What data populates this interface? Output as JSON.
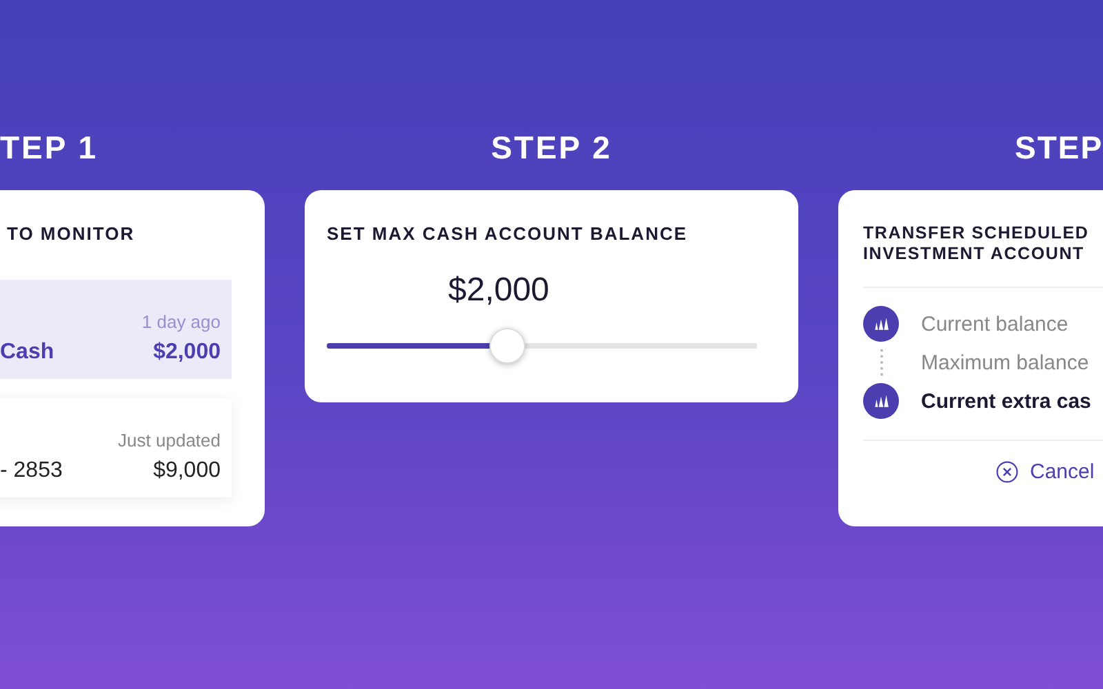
{
  "steps": [
    {
      "heading": "TEP 1",
      "card": {
        "kind": "accounts",
        "title": "TO MONITOR",
        "rows": [
          {
            "name": "Cash",
            "time": "1 day ago",
            "amount": "$2,000",
            "selected": true
          },
          {
            "name": "- 2853",
            "time": "Just updated",
            "amount": "$9,000",
            "selected": false
          }
        ]
      }
    },
    {
      "heading": "STEP 2",
      "card": {
        "kind": "slider",
        "title": "SET MAX CASH ACCOUNT BALANCE",
        "value": "$2,000",
        "level": 0.42
      }
    },
    {
      "heading": "STEP",
      "card": {
        "kind": "transfer",
        "title": "TRANSFER SCHEDULED INVESTMENT ACCOUNT",
        "items": [
          {
            "kind": "step",
            "label": "Current balance",
            "emphasized": false
          },
          {
            "kind": "note",
            "label": "Maximum balance",
            "emphasized": false
          },
          {
            "kind": "step",
            "label": "Current extra cas",
            "emphasized": true
          }
        ],
        "cancel": "Cancel"
      }
    }
  ]
}
